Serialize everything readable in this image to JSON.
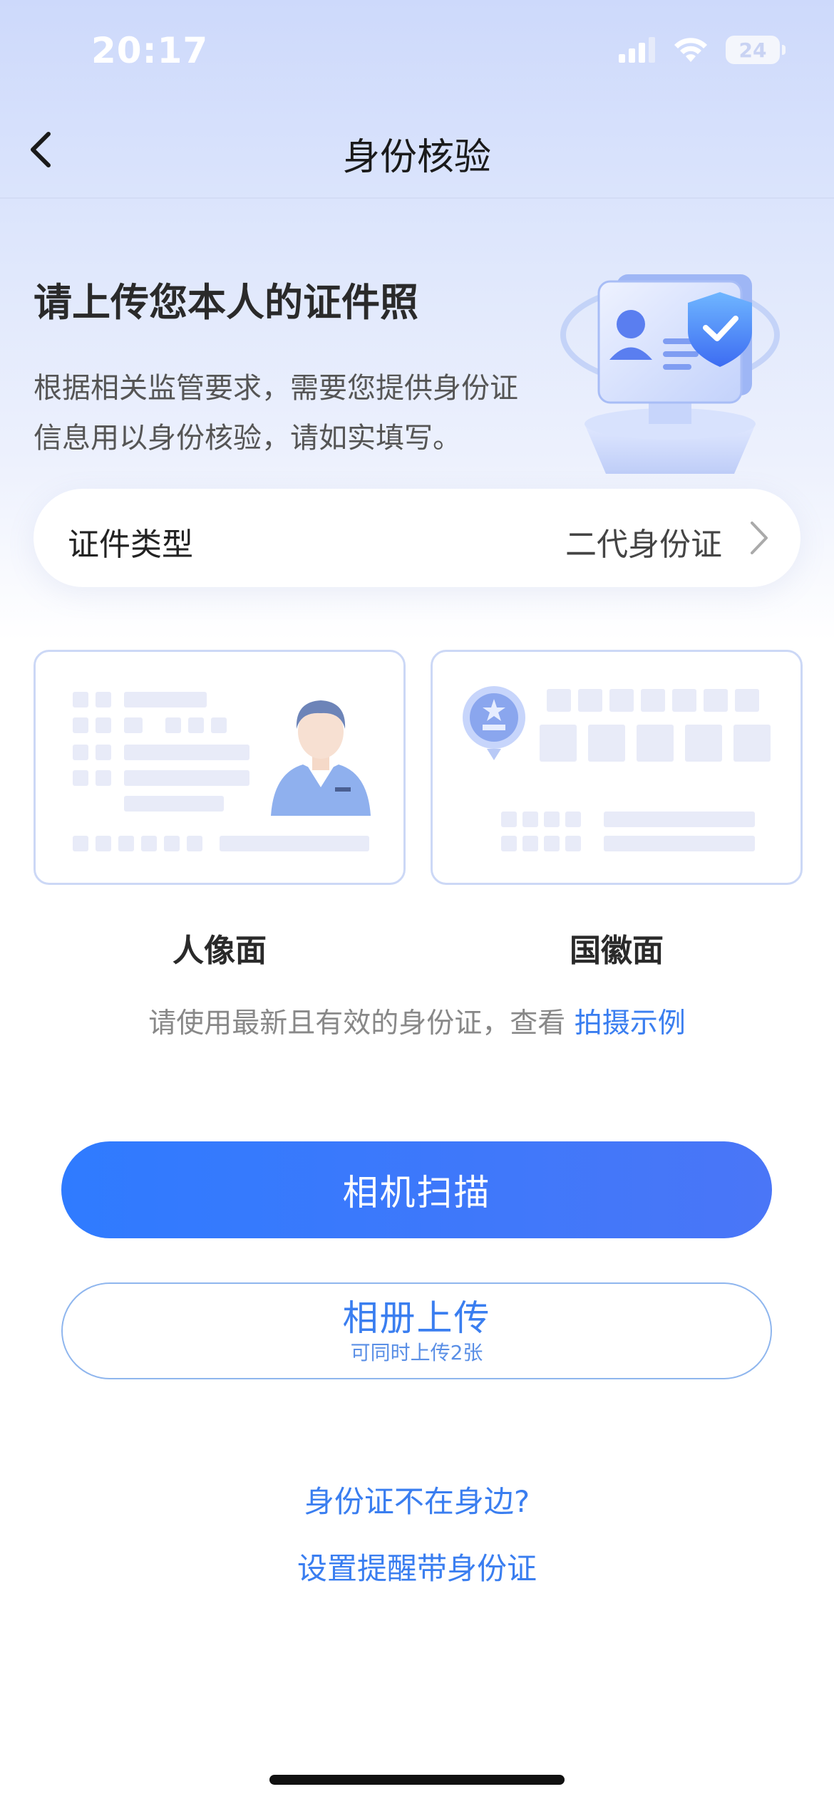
{
  "status_bar": {
    "time": "20:17",
    "battery": "24"
  },
  "nav": {
    "title": "身份核验"
  },
  "hero": {
    "title": "请上传您本人的证件照",
    "description": "根据相关监管要求，需要您提供身份证信息用以身份核验，请如实填写。"
  },
  "doc_type": {
    "label": "证件类型",
    "value": "二代身份证"
  },
  "id_cards": {
    "front_label": "人像面",
    "back_label": "国徽面"
  },
  "hint": {
    "text": "请使用最新且有效的身份证，查看 ",
    "link": "拍摄示例"
  },
  "actions": {
    "camera_scan": "相机扫描",
    "album_upload": "相册上传",
    "album_upload_sub": "可同时上传2张"
  },
  "links": {
    "no_id": "身份证不在身边?",
    "reminder": "设置提醒带身份证"
  },
  "colors": {
    "accent": "#3a7ef0",
    "primary_button": "#2f7bff"
  }
}
